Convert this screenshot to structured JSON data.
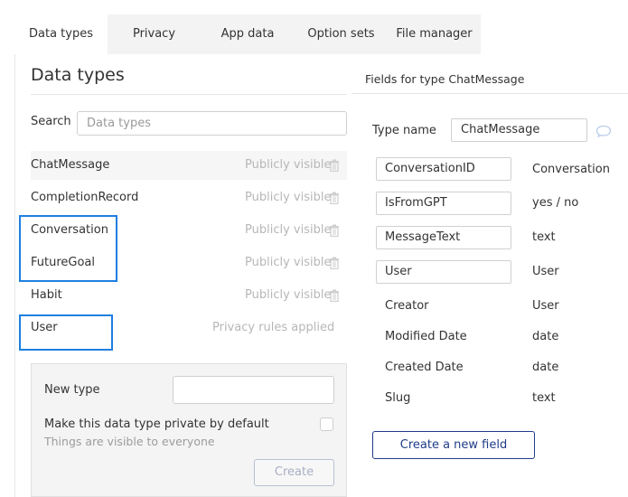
{
  "tabs": [
    "Data types",
    "Privacy",
    "App data",
    "Option sets",
    "File manager"
  ],
  "left": {
    "title": "Data types",
    "search": {
      "label": "Search",
      "placeholder": "Data types",
      "value": ""
    },
    "types": [
      {
        "name": "ChatMessage",
        "visibility": "Publicly visible",
        "selected": true,
        "has_trash": true
      },
      {
        "name": "CompletionRecord",
        "visibility": "Publicly visible",
        "selected": false,
        "has_trash": true
      },
      {
        "name": "Conversation",
        "visibility": "Publicly visible",
        "selected": false,
        "has_trash": true
      },
      {
        "name": "FutureGoal",
        "visibility": "Publicly visible",
        "selected": false,
        "has_trash": true
      },
      {
        "name": "Habit",
        "visibility": "Publicly visible",
        "selected": false,
        "has_trash": true
      },
      {
        "name": "User",
        "visibility": "Privacy rules applied",
        "selected": false,
        "has_trash": false
      }
    ],
    "new_type": {
      "label": "New type",
      "private_label": "Make this data type private by default",
      "private_sub": "Things are visible to everyone",
      "create_label": "Create"
    }
  },
  "right": {
    "title": "Fields for type ChatMessage",
    "type_name_label": "Type name",
    "type_name_value": "ChatMessage",
    "custom_fields": [
      {
        "name": "ConversationID",
        "type": "Conversation"
      },
      {
        "name": "IsFromGPT",
        "type": "yes / no"
      },
      {
        "name": "MessageText",
        "type": "text"
      },
      {
        "name": "User",
        "type": "User"
      }
    ],
    "builtin_fields": [
      {
        "name": "Creator",
        "type": "User"
      },
      {
        "name": "Modified Date",
        "type": "date"
      },
      {
        "name": "Created Date",
        "type": "date"
      },
      {
        "name": "Slug",
        "type": "text"
      }
    ],
    "create_field_label": "Create a new field"
  },
  "colors": {
    "highlight": "#1e7fe0",
    "primary_button": "#1f3c88",
    "muted_text": "#b7b7b7"
  },
  "icons": [
    "trash-icon",
    "chat-bubble-icon"
  ]
}
